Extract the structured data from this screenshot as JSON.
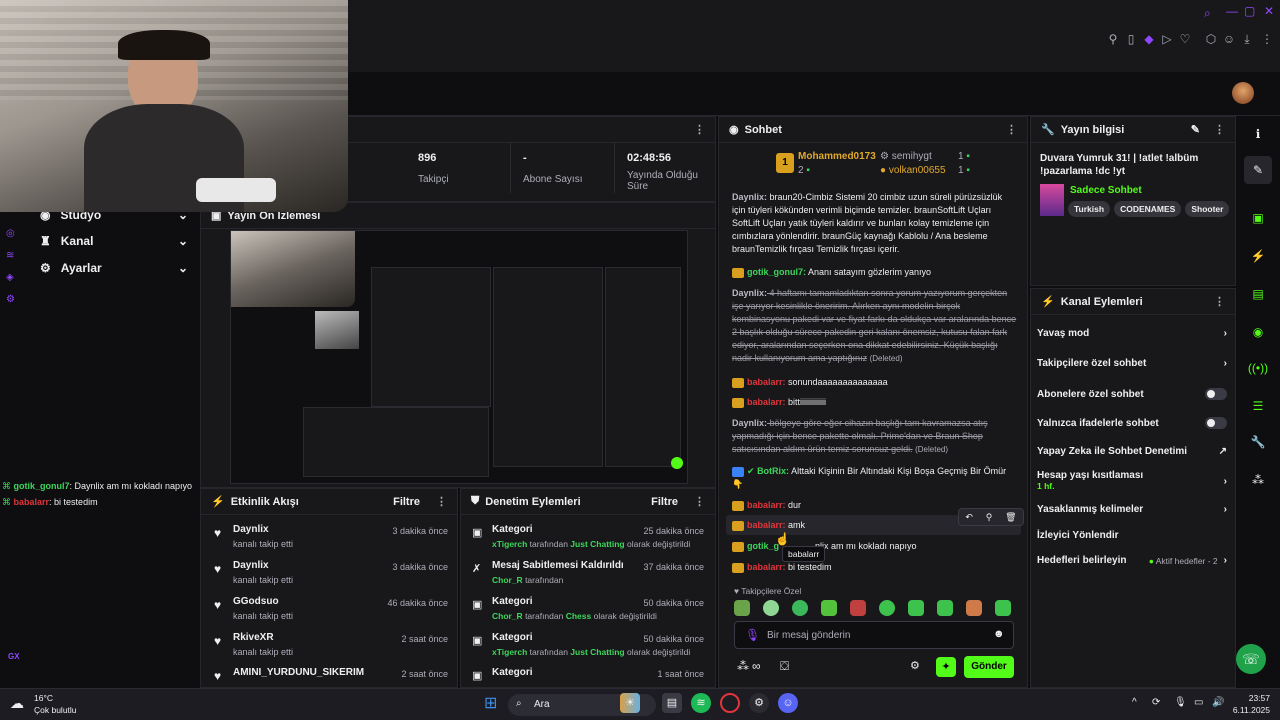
{
  "streamInfo": {
    "stats": [
      {
        "value": "896",
        "label": "Takipçi"
      },
      {
        "value": "-",
        "label": "Abone Sayısı"
      },
      {
        "value": "02:48:56",
        "label": "Yayında Olduğu Süre"
      }
    ]
  },
  "sidebar": {
    "items": [
      {
        "label": "Stüdyo"
      },
      {
        "label": "Kanal"
      },
      {
        "label": "Ayarlar"
      }
    ]
  },
  "preview": {
    "title": "Yayın Ön İzlemesi"
  },
  "leftChat": [
    {
      "user": "gotik_gonul7",
      "text": ": Daynlix am mı kokladı napıyo"
    },
    {
      "user": "babalarr",
      "text": ": bi testedim"
    }
  ],
  "activity": {
    "title": "Etkinlik Akışı",
    "filter": "Filtre",
    "items": [
      {
        "name": "Daynlix",
        "sub": "kanalı takip etti",
        "time": "3 dakika önce"
      },
      {
        "name": "Daynlix",
        "sub": "kanalı takip etti",
        "time": "3 dakika önce"
      },
      {
        "name": "GGodsuo",
        "sub": "kanalı takip etti",
        "time": "46 dakika önce"
      },
      {
        "name": "RkiveXR",
        "sub": "kanalı takip etti",
        "time": "2 saat önce"
      },
      {
        "name": "AMINI_YURDUNU_SIKERIM",
        "sub": "",
        "time": "2 saat önce"
      }
    ]
  },
  "moderation": {
    "title": "Denetim Eylemleri",
    "filter": "Filtre",
    "items": [
      {
        "name": "Kategori",
        "actor": "xTigerch",
        "mid": " tarafından ",
        "val": "Just Chatting",
        "end": " olarak değiştirildi",
        "time": "25 dakika önce"
      },
      {
        "name": "Mesaj Sabitlemesi Kaldırıldı",
        "actor": "Chor_R",
        "mid": " tarafından",
        "val": "",
        "end": "",
        "time": "37 dakika önce"
      },
      {
        "name": "Kategori",
        "actor": "Chor_R",
        "mid": " tarafından ",
        "val": "Chess",
        "end": " olarak değiştirildi",
        "time": "50 dakika önce"
      },
      {
        "name": "Kategori",
        "actor": "xTigerch",
        "mid": " tarafından ",
        "val": "Just Chatting",
        "end": " olarak değiştirildi",
        "time": "50 dakika önce"
      },
      {
        "name": "Kategori",
        "actor": "",
        "mid": "",
        "val": "",
        "end": "",
        "time": "1 saat önce"
      }
    ]
  },
  "chat": {
    "title": "Sohbet",
    "leaders": [
      {
        "rank": "1",
        "name": "Mohammed0173",
        "count": "2"
      },
      {
        "name": "semihygt",
        "count": "1"
      },
      {
        "name": "volkan00655",
        "count": "1"
      }
    ],
    "messages": [
      {
        "user": "Daynlix:",
        "text": " braun20-Cimbiz Sistemi 20 cimbiz uzun süreli pürüzsüzlük için tüyleri kökünden verimli biçimde temizler. braunSoftLift Uçları SoftLift Uçları yatık tüyleri kaldırır ve bunları kolay temizleme için cımbızlara yönlendirir. braunGüç kaynağı Kablolu / Ana besleme braunTemizlik fırçası Temizlik fırçası içerir."
      },
      {
        "user": "gotik_gonul7:",
        "text": " Ananı satayım gözlerim yanıyo"
      },
      {
        "user": "Daynlix:",
        "text": " 4 haftamı tamamladıktan sonra yorum yazıyorum gerçekten işe yarıyor kesinlikle öneririm. Alırken aynı modelin birçok kombinasyonu pakedi var ve fiyat farkı da oldukça var aralarında bence 2 başlık olduğu sürece pakedin geri kalanı önemsiz, kutusu falan fark ediyor, aralarından seçerken ona dikkat edebilirsiniz. Küçük başlığı nadir kullanıyorum ama yaptığınız",
        "deleted": "(Deleted)"
      },
      {
        "user": "babalarr:",
        "text": " sonundaaaaaaaaaaaaaa"
      },
      {
        "user": "babalarr:",
        "text": " bittiiiiiiiiiiiii"
      },
      {
        "user": "Daynlix:",
        "text": " bölgeye göre eğer cihazın başlığı tam kavramazsa atış yapmadığı için bence pakette olmalı. Prime'dan ve Braun Shop satıcısından aldım ürün temiz sorunsuz geldi.",
        "deleted": "(Deleted)"
      },
      {
        "user": "BotRix:",
        "text": " Alttaki Kişinin Bir Altındaki Kişi Boşa Geçmiş Bir Ömür👇"
      },
      {
        "user": "babalarr:",
        "text": " dur"
      },
      {
        "user": "babalarr:",
        "text": " amk"
      },
      {
        "user": "gotik_g",
        "text": "nlix am mı kokladı napıyo"
      },
      {
        "user": "babalarr:",
        "text": " bi testedim"
      }
    ],
    "tooltip": "babalarr",
    "followerOnly": "Takipçilere Özel",
    "inputPlaceholder": "Bir mesaj gönderin",
    "sendLabel": "Gönder"
  },
  "infoPanel": {
    "title": "Yayın bilgisi",
    "streamTitle": "Duvara Yumruk 31! | !atlet !albüm !pazarlama !dc !yt",
    "category": "Sadece Sohbet",
    "tags": [
      "Turkish",
      "CODENAMES",
      "Shooter"
    ]
  },
  "channelActions": {
    "title": "Kanal Eylemleri",
    "items": [
      {
        "label": "Yavaş mod",
        "kind": "chev"
      },
      {
        "label": "Takipçilere özel sohbet",
        "kind": "chev"
      },
      {
        "label": "Abonelere özel sohbet",
        "kind": "toggle"
      },
      {
        "label": "Yalnızca ifadelerle sohbet",
        "kind": "toggle"
      },
      {
        "label": "Yapay Zeka ile Sohbet Denetimi",
        "kind": "ext"
      },
      {
        "label": "Hesap yaşı kısıtlaması",
        "sub": "1 hf.",
        "kind": "chev"
      },
      {
        "label": "Yasaklanmış kelimeler",
        "kind": "chev"
      },
      {
        "label": "İzleyici Yönlendir",
        "kind": "none"
      },
      {
        "label": "Hedefleri belirleyin",
        "extra": "Aktif hedefler - 2",
        "kind": "chev"
      }
    ]
  },
  "taskbar": {
    "weatherTemp": "16°C",
    "weatherDesc": "Çok bulutlu",
    "search": "Ara",
    "time": "23:57",
    "date": "6.11.2025",
    "gx": "GX"
  },
  "colors": {
    "accent": "#53fc18",
    "brand": "#9147ff"
  }
}
